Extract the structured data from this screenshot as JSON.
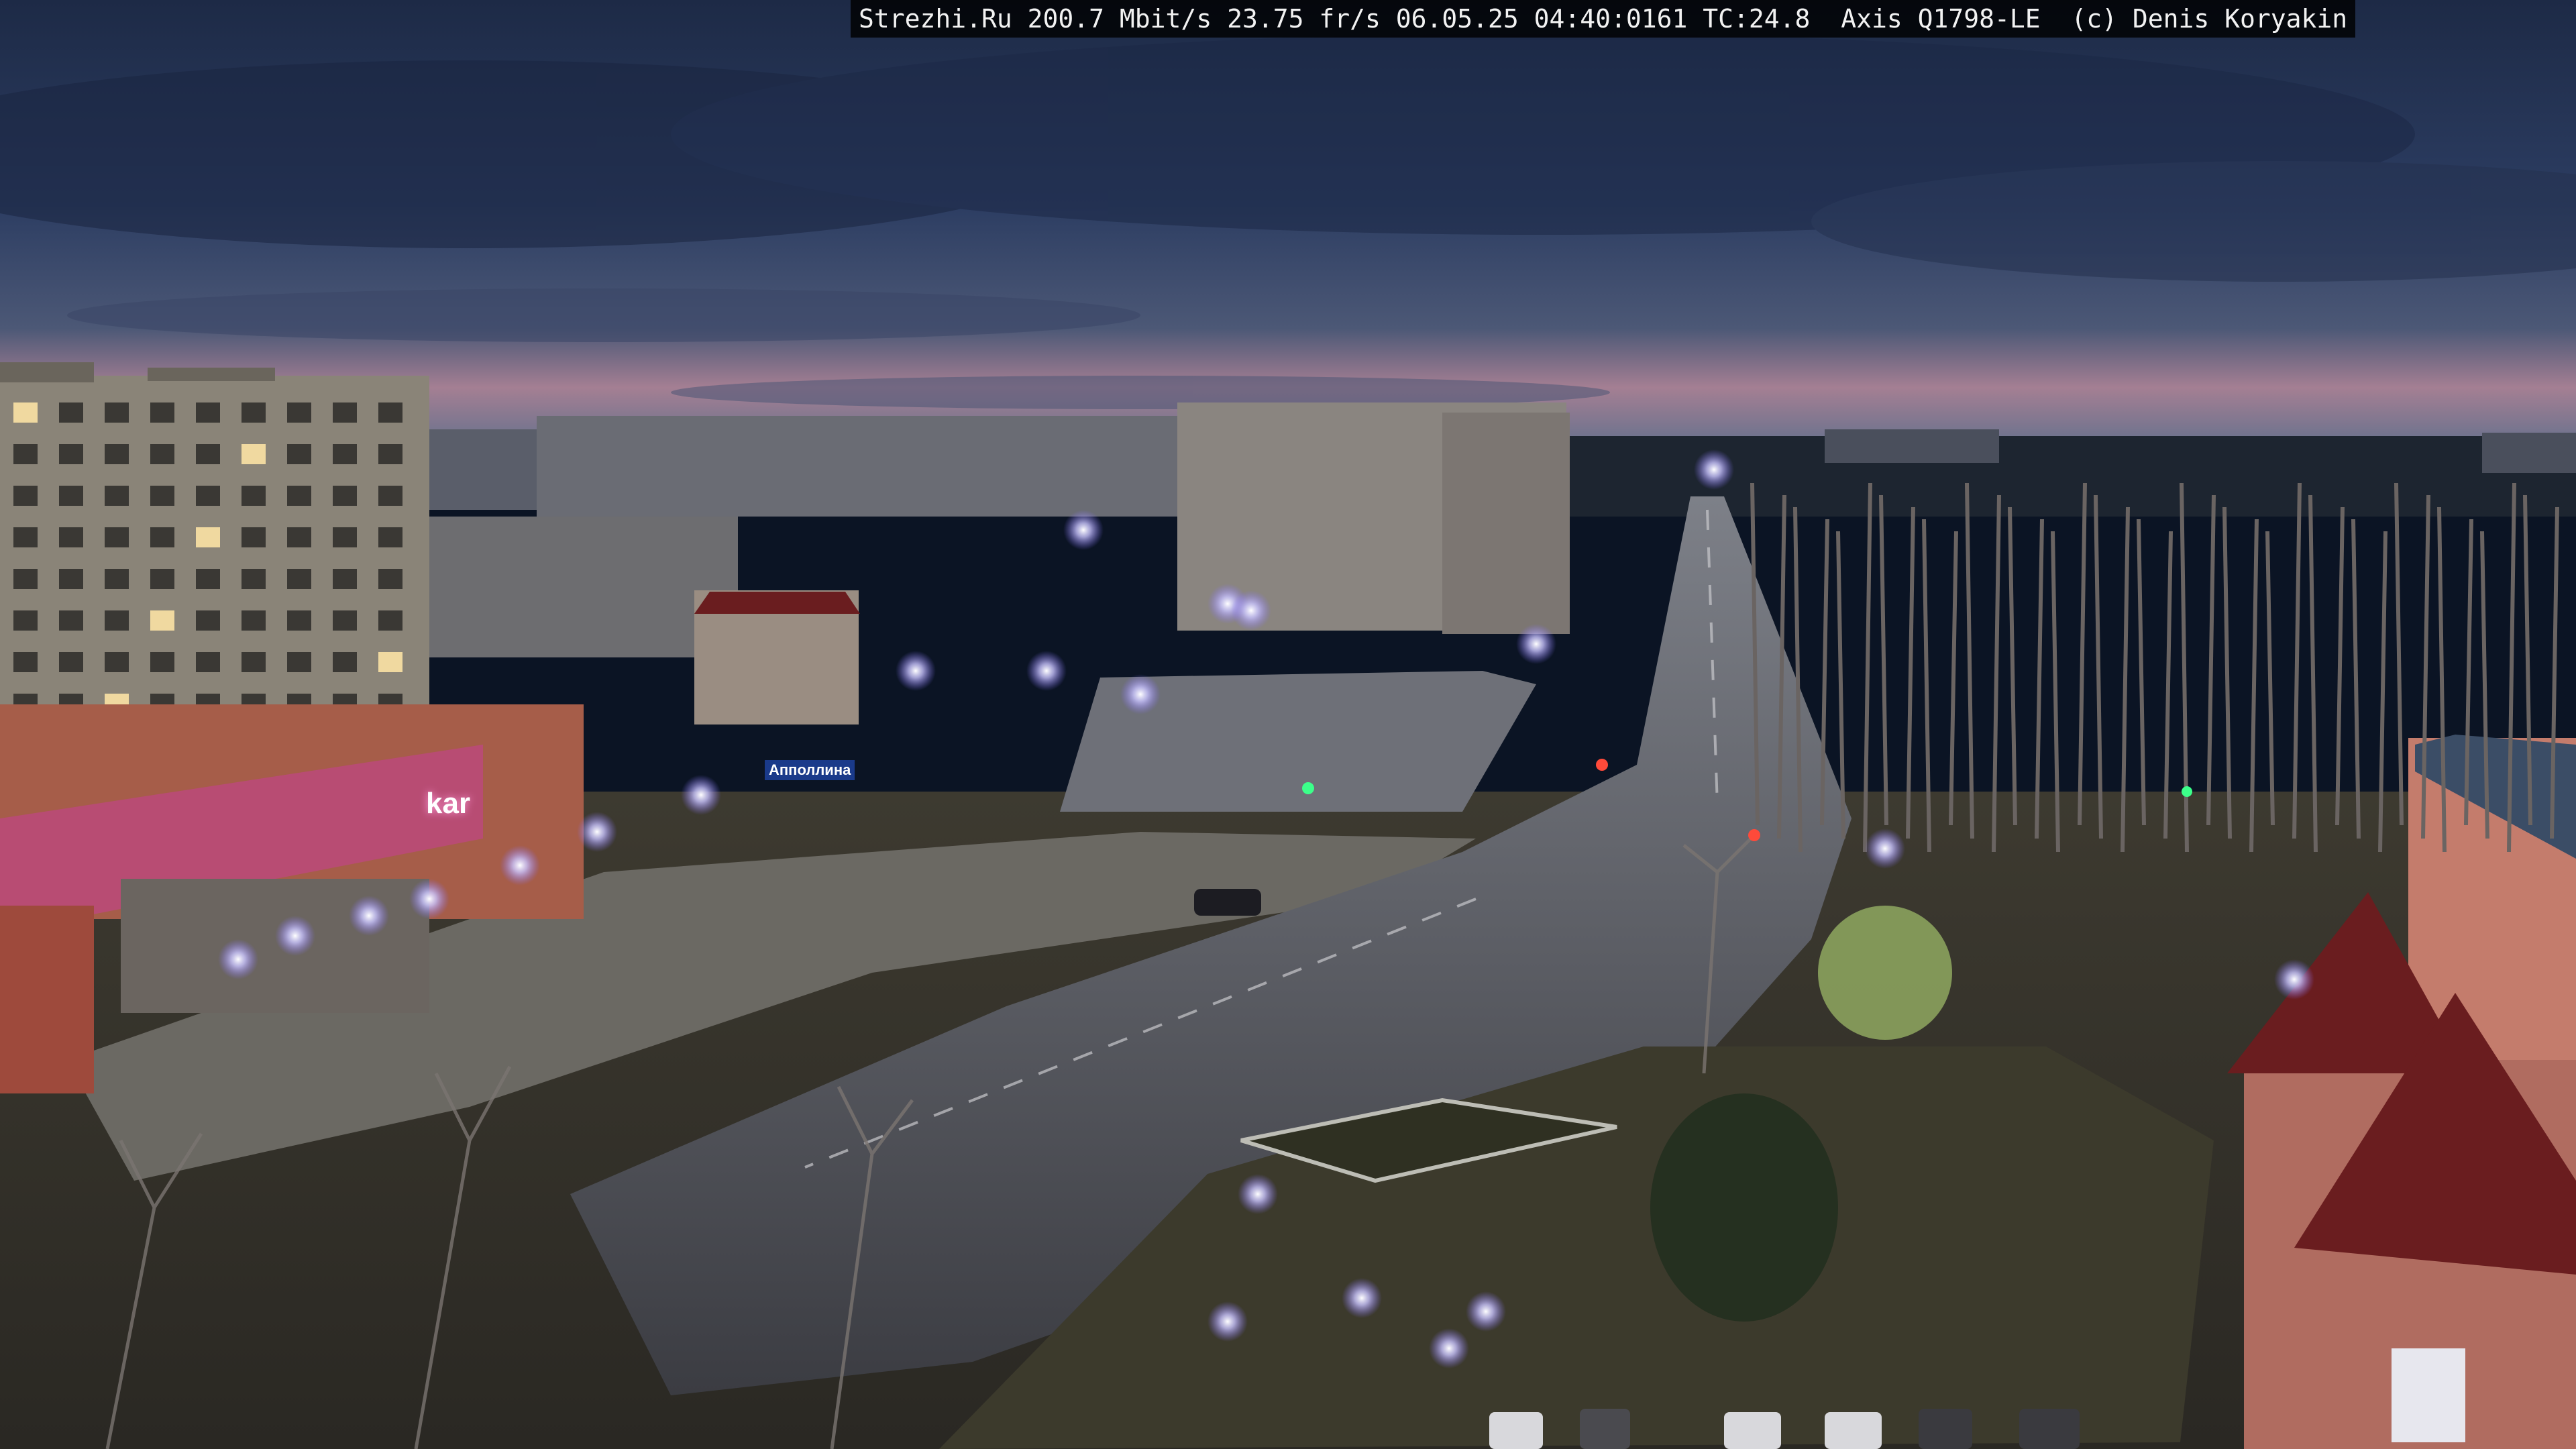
{
  "overlay": {
    "text": "Strezhi.Ru 200.7 Mbit/s 23.75 fr/s 06.05.25 04:40:0161 TC:24.8  Axis Q1798-LE  (c) Denis Koryakin"
  },
  "signs": {
    "store_left": "",
    "store_main": "kar",
    "small_shop": "Апполлина"
  },
  "colors": {
    "sky_top": "#2a3a5c",
    "sky_dusk": "#b98a9a",
    "street_light": "#e8e6ff",
    "store_facade": "#b86a5a",
    "roof_red": "#7a1f22"
  }
}
